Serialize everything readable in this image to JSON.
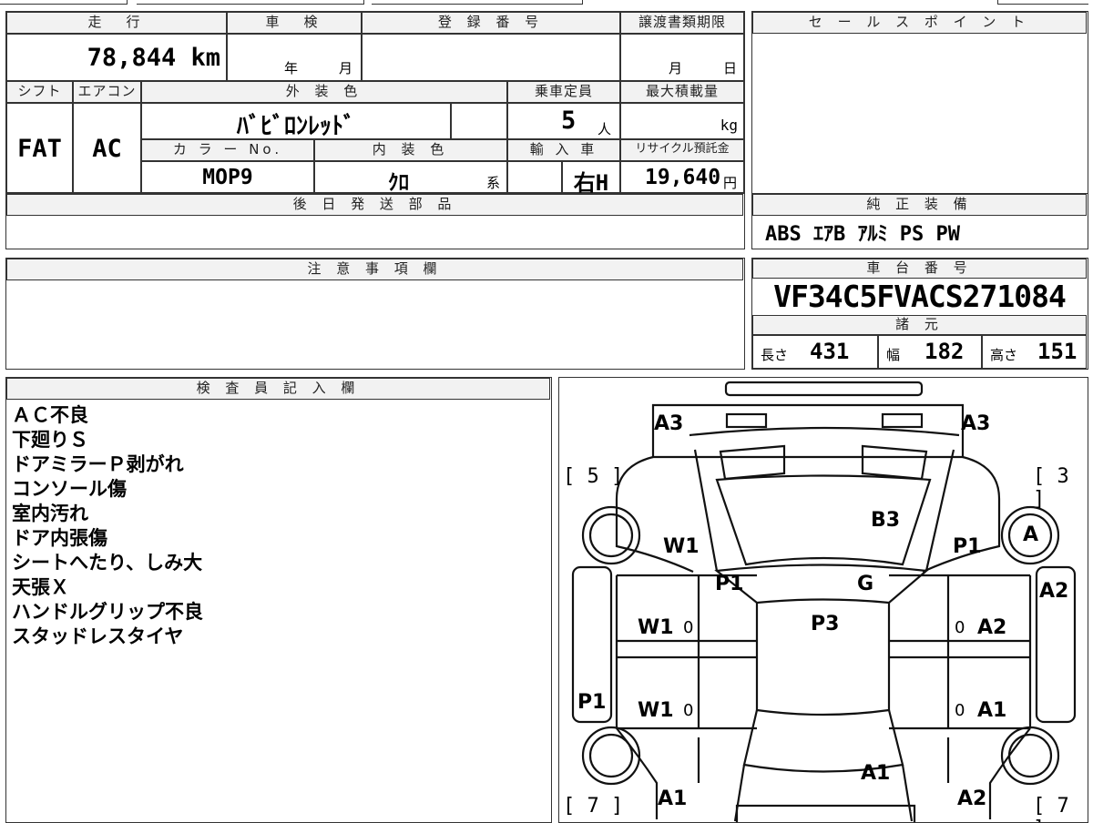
{
  "specs": {
    "headers": {
      "mileage": "走　行",
      "inspection": "車　検",
      "registration": "登 録 番 号",
      "transfer_deadline": "譲渡書類期限",
      "shift": "シフト",
      "aircon": "エアコン",
      "exterior_color": "外 装 色",
      "capacity": "乗車定員",
      "max_load": "最大積載量",
      "color_no": "カ ラ ー No.",
      "interior_color": "内 装 色",
      "import": "輸 入 車",
      "recycle": "リサイクル預託金"
    },
    "mileage": "78,844",
    "mileage_unit": "km",
    "inspection_year": "年",
    "inspection_month": "月",
    "registration_value": "",
    "transfer_month": "月",
    "transfer_day": "日",
    "shift": "FAT",
    "aircon": "AC",
    "exterior_color": "ﾊﾞﾋﾞﾛﾝﾚｯﾄﾞ",
    "capacity": "5",
    "capacity_unit": "人",
    "max_load_unit": "kg",
    "color_no": "MOP9",
    "interior_color": "ｸﾛ",
    "interior_suffix": "系",
    "import_value": "右H",
    "recycle_value": "19,640",
    "recycle_unit": "円"
  },
  "later_parts": {
    "header": "後 日 発 送 部 品",
    "value": ""
  },
  "notes_box": {
    "header": "注 意 事 項 欄",
    "value": ""
  },
  "sales_point": {
    "header": "セ ー ル ス ポ イ ン ト",
    "value": ""
  },
  "equipment": {
    "header": "純 正 装 備",
    "value": "ABS ｴｱB ｱﾙﾐ PS PW"
  },
  "chassis": {
    "header": "車 台 番 号",
    "value": "VF34C5FVACS271084"
  },
  "dimensions": {
    "header": "諸 元",
    "length_label": "長さ",
    "length": "431",
    "width_label": "幅",
    "width": "182",
    "height_label": "高さ",
    "height": "151"
  },
  "inspector": {
    "header": "検 査 員 記 入 欄",
    "lines": [
      "ＡＣ不良",
      "下廻りＳ",
      "ドアミラーＰ剥がれ",
      "コンソール傷",
      "室内汚れ",
      "ドア内張傷",
      "シートへたり、しみ大",
      "天張Ｘ",
      "ハンドルグリップ不良",
      "スタッドレスタイヤ"
    ]
  },
  "diagram": {
    "labels": {
      "a3_left": "A3",
      "a3_right": "A3",
      "b3": "B3",
      "w1_hood": "W1",
      "p1_hood": "P1",
      "tire_a": "A",
      "p1_pillar": "P1",
      "g": "G",
      "a2_right_side": "A2",
      "w1_front_door": "W1",
      "zero1": "0",
      "p3": "P3",
      "zero2": "0",
      "a2_front_door": "A2",
      "p1_left_side": "P1",
      "w1_rear_door": "W1",
      "zero3": "0",
      "zero4": "0",
      "a1_rear_door": "A1",
      "a1_roof": "A1",
      "a1_rear": "A1",
      "a2_rear": "A2"
    },
    "brackets": {
      "tl": "[ 5 ]",
      "tr": "[ 3 ]",
      "bl": "[ 7 ]",
      "br": "[ 7 ]"
    }
  }
}
